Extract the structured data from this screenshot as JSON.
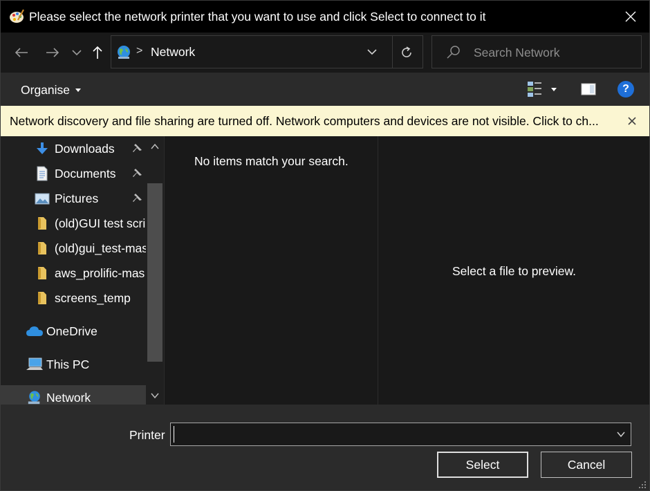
{
  "window": {
    "title": "Please select the network printer that you want to use and click Select to connect to it",
    "icons": {
      "app": "paint-palette-icon",
      "close": "close-icon"
    }
  },
  "nav": {
    "back_icon": "arrow-left-icon",
    "forward_icon": "arrow-right-icon",
    "recent_icon": "chevron-down-icon",
    "up_icon": "arrow-up-icon",
    "address": {
      "icon": "network-globe-icon",
      "separator": ">",
      "location": "Network"
    },
    "refresh_icon": "refresh-icon",
    "search": {
      "placeholder": "Search Network",
      "icon": "search-icon"
    }
  },
  "toolbar": {
    "organise_label": "Organise",
    "view_icon": "view-options-icon",
    "preview_pane_icon": "preview-pane-icon",
    "help_label": "?"
  },
  "infobar": {
    "message": "Network discovery and file sharing are turned off. Network computers and devices are not visible. Click to ch...",
    "background": "#fbf6d2"
  },
  "sidebar": {
    "items": [
      {
        "label": "Downloads",
        "icon": "download-arrow-icon",
        "pinned": true
      },
      {
        "label": "Documents",
        "icon": "document-icon",
        "pinned": true
      },
      {
        "label": "Pictures",
        "icon": "pictures-icon",
        "pinned": true
      },
      {
        "label": "(old)GUI test scri",
        "icon": "folder-icon",
        "pinned": false
      },
      {
        "label": "(old)gui_test-mas",
        "icon": "folder-icon",
        "pinned": false
      },
      {
        "label": "aws_prolific-mas",
        "icon": "folder-icon",
        "pinned": false
      },
      {
        "label": "screens_temp",
        "icon": "folder-icon",
        "pinned": false
      },
      {
        "label": "OneDrive",
        "icon": "cloud-icon",
        "pinned": false
      },
      {
        "label": "This PC",
        "icon": "computer-icon",
        "pinned": false
      },
      {
        "label": "Network",
        "icon": "network-globe-icon",
        "pinned": false,
        "selected": true
      }
    ]
  },
  "content": {
    "empty_message": "No items match your search."
  },
  "preview": {
    "message": "Select a file to preview."
  },
  "footer": {
    "printer_label": "Printer",
    "printer_value": "",
    "select_label": "Select",
    "cancel_label": "Cancel"
  },
  "colors": {
    "titlebar": "#000000",
    "window": "#202020",
    "accent_help": "#1e6fd8",
    "folder": "#e8c25d"
  }
}
